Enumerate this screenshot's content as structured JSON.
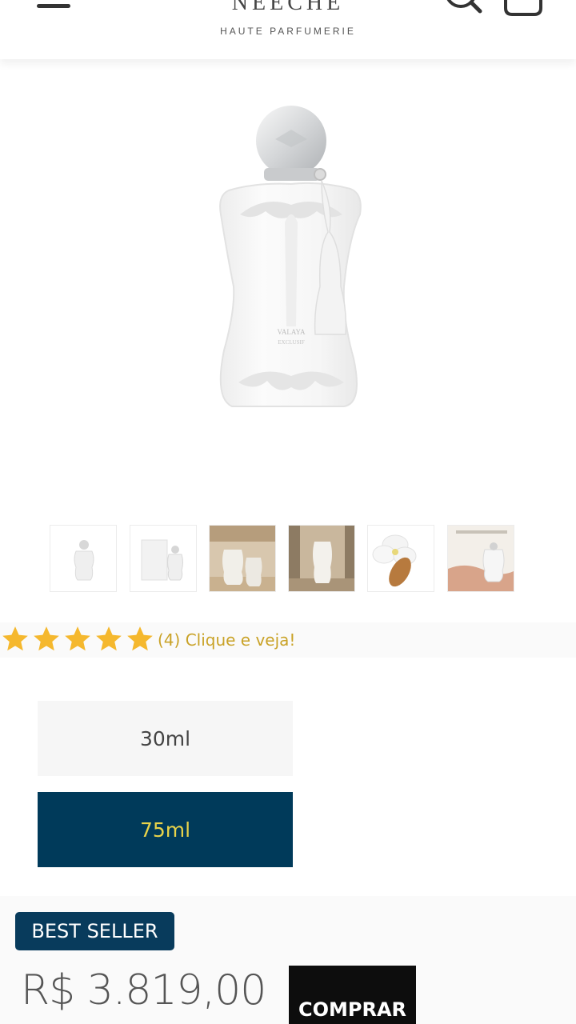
{
  "header": {
    "brand_name": "NEECHE",
    "brand_subtitle": "HAUTE PARFUMERIE",
    "icons": [
      "menu-icon",
      "search-icon",
      "cart-icon"
    ]
  },
  "product": {
    "main_image": "perfume-bottle",
    "thumbnails": [
      "bottle-front",
      "bottle-with-box",
      "two-bottles-beige",
      "bottle-in-hall",
      "flower-and-almond",
      "bottle-in-hand"
    ]
  },
  "rating": {
    "stars": 5,
    "text": "(4) Clique e veja!"
  },
  "sizes": [
    {
      "label": "30ml",
      "selected": false
    },
    {
      "label": "75ml",
      "selected": true
    }
  ],
  "purchase": {
    "badge": "BEST SELLER",
    "price": "R$ 3.819,00",
    "buy_label": "COMPRAR"
  },
  "colors": {
    "accent_navy": "#003a5a",
    "selected_text": "#e8d34a",
    "star_gold": "#f5b82e",
    "link_gold": "#c9a227"
  }
}
